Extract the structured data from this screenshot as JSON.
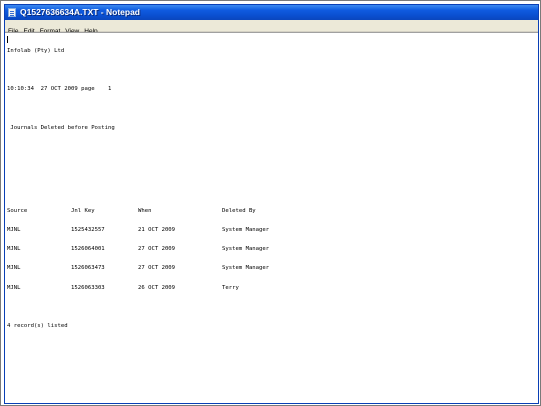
{
  "window": {
    "title": "Q1527636634A.TXT - Notepad"
  },
  "menu": [
    "File",
    "Edit",
    "Format",
    "View",
    "Help"
  ],
  "document": {
    "company": "Infolab (Pty) Ltd",
    "header_line": "10:10:34  27 OCT 2009 page    1",
    "report_title": " Journals Deleted before Posting",
    "columns": [
      "Source",
      "Jnl Key",
      "When",
      "Deleted By"
    ],
    "rows": [
      [
        "MJNL",
        "1525432557",
        "21 OCT 2009",
        "System Manager"
      ],
      [
        "MJNL",
        "1526064001",
        "27 OCT 2009",
        "System Manager"
      ],
      [
        "MJNL",
        "1526063473",
        "27 OCT 2009",
        "System Manager"
      ],
      [
        "MJNL",
        "1526063303",
        "26 OCT 2009",
        "Terry"
      ]
    ],
    "footer": "4 record(s) listed"
  }
}
